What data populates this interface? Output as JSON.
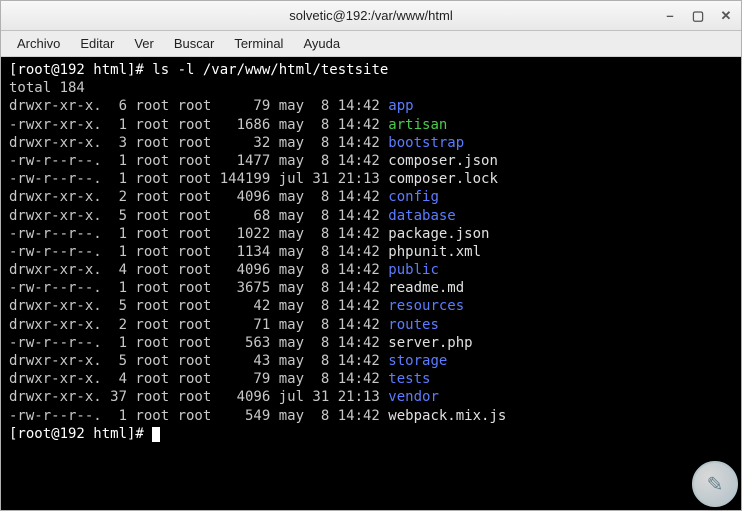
{
  "window": {
    "title": "solvetic@192:/var/www/html"
  },
  "menubar": {
    "items": [
      "Archivo",
      "Editar",
      "Ver",
      "Buscar",
      "Terminal",
      "Ayuda"
    ]
  },
  "terminal": {
    "prompt": "[root@192 html]#",
    "command": "ls -l /var/www/html/testsite",
    "total_line": "total 184",
    "entries": [
      {
        "perm": "drwxr-xr-x.",
        "links": "6",
        "owner": "root",
        "group": "root",
        "size": "79",
        "month": "may",
        "day": "8",
        "time": "14:42",
        "name": "app",
        "type": "dir"
      },
      {
        "perm": "-rwxr-xr-x.",
        "links": "1",
        "owner": "root",
        "group": "root",
        "size": "1686",
        "month": "may",
        "day": "8",
        "time": "14:42",
        "name": "artisan",
        "type": "exec"
      },
      {
        "perm": "drwxr-xr-x.",
        "links": "3",
        "owner": "root",
        "group": "root",
        "size": "32",
        "month": "may",
        "day": "8",
        "time": "14:42",
        "name": "bootstrap",
        "type": "dir"
      },
      {
        "perm": "-rw-r--r--.",
        "links": "1",
        "owner": "root",
        "group": "root",
        "size": "1477",
        "month": "may",
        "day": "8",
        "time": "14:42",
        "name": "composer.json",
        "type": "file"
      },
      {
        "perm": "-rw-r--r--.",
        "links": "1",
        "owner": "root",
        "group": "root",
        "size": "144199",
        "month": "jul",
        "day": "31",
        "time": "21:13",
        "name": "composer.lock",
        "type": "file"
      },
      {
        "perm": "drwxr-xr-x.",
        "links": "2",
        "owner": "root",
        "group": "root",
        "size": "4096",
        "month": "may",
        "day": "8",
        "time": "14:42",
        "name": "config",
        "type": "dir"
      },
      {
        "perm": "drwxr-xr-x.",
        "links": "5",
        "owner": "root",
        "group": "root",
        "size": "68",
        "month": "may",
        "day": "8",
        "time": "14:42",
        "name": "database",
        "type": "dir"
      },
      {
        "perm": "-rw-r--r--.",
        "links": "1",
        "owner": "root",
        "group": "root",
        "size": "1022",
        "month": "may",
        "day": "8",
        "time": "14:42",
        "name": "package.json",
        "type": "file"
      },
      {
        "perm": "-rw-r--r--.",
        "links": "1",
        "owner": "root",
        "group": "root",
        "size": "1134",
        "month": "may",
        "day": "8",
        "time": "14:42",
        "name": "phpunit.xml",
        "type": "file"
      },
      {
        "perm": "drwxr-xr-x.",
        "links": "4",
        "owner": "root",
        "group": "root",
        "size": "4096",
        "month": "may",
        "day": "8",
        "time": "14:42",
        "name": "public",
        "type": "dir"
      },
      {
        "perm": "-rw-r--r--.",
        "links": "1",
        "owner": "root",
        "group": "root",
        "size": "3675",
        "month": "may",
        "day": "8",
        "time": "14:42",
        "name": "readme.md",
        "type": "file"
      },
      {
        "perm": "drwxr-xr-x.",
        "links": "5",
        "owner": "root",
        "group": "root",
        "size": "42",
        "month": "may",
        "day": "8",
        "time": "14:42",
        "name": "resources",
        "type": "dir"
      },
      {
        "perm": "drwxr-xr-x.",
        "links": "2",
        "owner": "root",
        "group": "root",
        "size": "71",
        "month": "may",
        "day": "8",
        "time": "14:42",
        "name": "routes",
        "type": "dir"
      },
      {
        "perm": "-rw-r--r--.",
        "links": "1",
        "owner": "root",
        "group": "root",
        "size": "563",
        "month": "may",
        "day": "8",
        "time": "14:42",
        "name": "server.php",
        "type": "file"
      },
      {
        "perm": "drwxr-xr-x.",
        "links": "5",
        "owner": "root",
        "group": "root",
        "size": "43",
        "month": "may",
        "day": "8",
        "time": "14:42",
        "name": "storage",
        "type": "dir"
      },
      {
        "perm": "drwxr-xr-x.",
        "links": "4",
        "owner": "root",
        "group": "root",
        "size": "79",
        "month": "may",
        "day": "8",
        "time": "14:42",
        "name": "tests",
        "type": "dir"
      },
      {
        "perm": "drwxr-xr-x.",
        "links": "37",
        "owner": "root",
        "group": "root",
        "size": "4096",
        "month": "jul",
        "day": "31",
        "time": "21:13",
        "name": "vendor",
        "type": "dir"
      },
      {
        "perm": "-rw-r--r--.",
        "links": "1",
        "owner": "root",
        "group": "root",
        "size": "549",
        "month": "may",
        "day": "8",
        "time": "14:42",
        "name": "webpack.mix.js",
        "type": "file"
      }
    ]
  }
}
